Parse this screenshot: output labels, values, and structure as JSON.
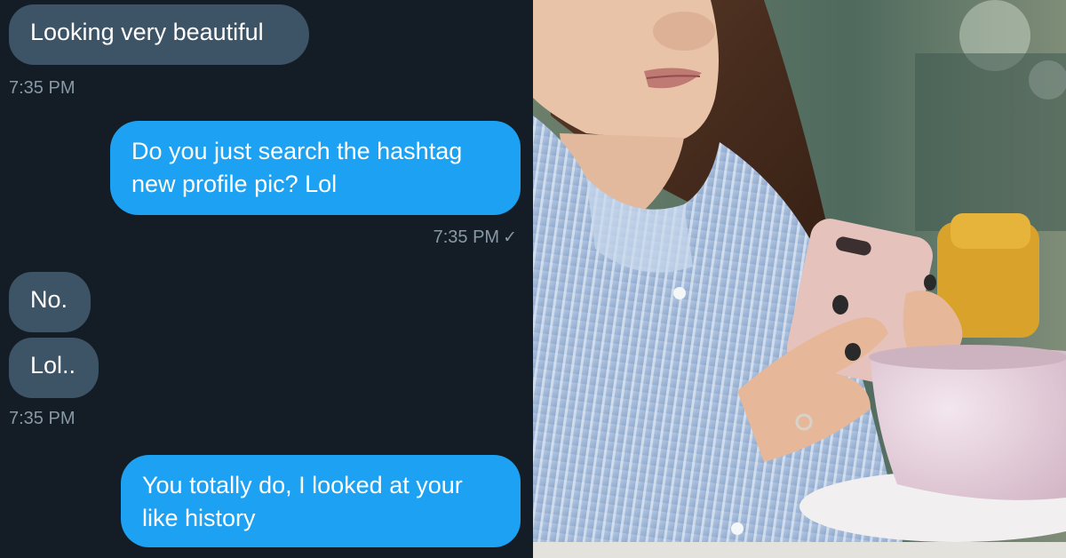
{
  "chat": {
    "messages": [
      {
        "direction": "incoming",
        "text": "Looking very beautiful"
      },
      {
        "direction": "outgoing",
        "text": "Do you just search the hashtag\nnew profile pic? Lol"
      },
      {
        "direction": "incoming",
        "text": "No."
      },
      {
        "direction": "incoming",
        "text": "Lol.."
      },
      {
        "direction": "outgoing",
        "text": "You totally do, I looked at your\nlike history"
      }
    ],
    "timestamps": [
      {
        "text": "7:35 PM"
      },
      {
        "text": "7:35 PM",
        "status_icon": "read-check-icon",
        "status_glyph": "✓"
      },
      {
        "text": "7:35 PM"
      }
    ],
    "colors": {
      "background": "#141d26",
      "incoming_bubble": "#3d5366",
      "outgoing_bubble": "#1da1f2",
      "timestamp_text": "#8899a6"
    }
  },
  "photo": {
    "subject": "woman-in-striped-shirt-looking-at-phone-icon"
  }
}
